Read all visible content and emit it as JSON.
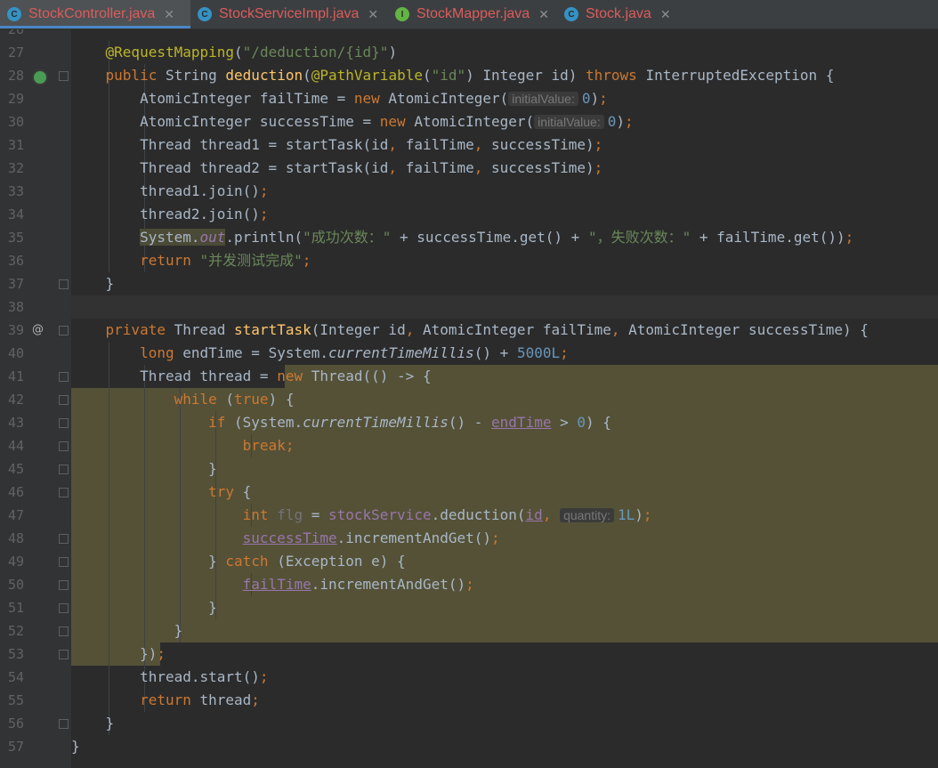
{
  "tabs": [
    {
      "label": "StockController.java",
      "icon": "class-icon",
      "icon_letter": "C",
      "icon_color": "#3592c4",
      "color": "#db5c5c",
      "active": true
    },
    {
      "label": "StockServiceImpl.java",
      "icon": "class-icon",
      "icon_letter": "C",
      "icon_color": "#3592c4",
      "color": "#db5c5c",
      "active": false
    },
    {
      "label": "StockMapper.java",
      "icon": "interface-icon",
      "icon_letter": "I",
      "icon_color": "#62b543",
      "color": "#db5c5c",
      "active": false
    },
    {
      "label": "Stock.java",
      "icon": "class-icon",
      "icon_letter": "C",
      "icon_color": "#3592c4",
      "color": "#db5c5c",
      "active": false
    }
  ],
  "close_glyph": "✕",
  "gutter_icons": {
    "line28": "run-controller-icon",
    "line39": "override-icon",
    "line39_glyph": "@"
  },
  "lines": [
    {
      "n": "26",
      "t": []
    },
    {
      "n": "27",
      "t": [
        [
          "    "
        ],
        [
          "@RequestMapping",
          "ann"
        ],
        [
          "("
        ],
        [
          "\"/deduction/{id}\"",
          "str"
        ],
        [
          ")"
        ]
      ]
    },
    {
      "n": "28",
      "t": [
        [
          "    "
        ],
        [
          "public ",
          "kw"
        ],
        [
          "String "
        ],
        [
          "deduction",
          "fn"
        ],
        [
          "("
        ],
        [
          "@PathVariable",
          "ann"
        ],
        [
          "("
        ],
        [
          "\"id\"",
          "str"
        ],
        [
          ") Integer id) "
        ],
        [
          "throws ",
          "kw"
        ],
        [
          "InterruptedException {"
        ]
      ]
    },
    {
      "n": "29",
      "t": [
        [
          "        AtomicInteger failTime = "
        ],
        [
          "new ",
          "kw"
        ],
        [
          "AtomicInteger("
        ],
        [
          "initialValue:",
          "hint"
        ],
        [
          "0",
          "num"
        ],
        [
          ")"
        ],
        [
          ";",
          "kw"
        ]
      ]
    },
    {
      "n": "30",
      "t": [
        [
          "        AtomicInteger successTime = "
        ],
        [
          "new ",
          "kw"
        ],
        [
          "AtomicInteger("
        ],
        [
          "initialValue:",
          "hint"
        ],
        [
          "0",
          "num"
        ],
        [
          ")"
        ],
        [
          ";",
          "kw"
        ]
      ]
    },
    {
      "n": "31",
      "t": [
        [
          "        Thread thread1 = startTask(id"
        ],
        [
          ", ",
          "kw"
        ],
        [
          "failTime"
        ],
        [
          ", ",
          "kw"
        ],
        [
          "successTime)"
        ],
        [
          ";",
          "kw"
        ]
      ]
    },
    {
      "n": "32",
      "t": [
        [
          "        Thread thread2 = startTask(id"
        ],
        [
          ", ",
          "kw"
        ],
        [
          "failTime"
        ],
        [
          ", ",
          "kw"
        ],
        [
          "successTime)"
        ],
        [
          ";",
          "kw"
        ]
      ]
    },
    {
      "n": "33",
      "t": [
        [
          "        thread1.join()"
        ],
        [
          ";",
          "kw"
        ]
      ]
    },
    {
      "n": "34",
      "t": [
        [
          "        thread2.join()"
        ],
        [
          ";",
          "kw"
        ]
      ]
    },
    {
      "n": "35",
      "t": [
        [
          "        "
        ],
        [
          "System.",
          "sysbg"
        ],
        [
          "out",
          "fld sysbg"
        ],
        [
          ".println("
        ],
        [
          "\"成功次数：\"",
          "str"
        ],
        [
          " + successTime.get() + "
        ],
        [
          "\"，失败次数：\"",
          "str"
        ],
        [
          " + failTime.get())"
        ],
        [
          ";",
          "kw"
        ]
      ]
    },
    {
      "n": "36",
      "t": [
        [
          "        "
        ],
        [
          "return ",
          "kw"
        ],
        [
          "\"并发测试完成\"",
          "str"
        ],
        [
          ";",
          "kw"
        ]
      ]
    },
    {
      "n": "37",
      "t": [
        [
          "    }"
        ]
      ]
    },
    {
      "n": "38",
      "t": []
    },
    {
      "n": "39",
      "t": [
        [
          "    "
        ],
        [
          "private ",
          "kw"
        ],
        [
          "Thread "
        ],
        [
          "startTask",
          "fn"
        ],
        [
          "(Integer id"
        ],
        [
          ", ",
          "kw"
        ],
        [
          "AtomicInteger failTime"
        ],
        [
          ", ",
          "kw"
        ],
        [
          "AtomicInteger successTime) {"
        ]
      ]
    },
    {
      "n": "40",
      "t": [
        [
          "        "
        ],
        [
          "long ",
          "kw"
        ],
        [
          "endTime = System."
        ],
        [
          "currentTimeMillis",
          "st"
        ],
        [
          "() + "
        ],
        [
          "5000L",
          "num"
        ],
        [
          ";",
          "kw"
        ]
      ]
    },
    {
      "n": "41",
      "t": [
        [
          "        Thread thread = "
        ],
        [
          "new ",
          "kw"
        ],
        [
          "Thread(() -> {"
        ]
      ]
    },
    {
      "n": "42",
      "t": [
        [
          "            "
        ],
        [
          "while ",
          "kw"
        ],
        [
          "("
        ],
        [
          "true",
          "kw"
        ],
        [
          ") {"
        ]
      ]
    },
    {
      "n": "43",
      "t": [
        [
          "                "
        ],
        [
          "if ",
          "kw"
        ],
        [
          "(System."
        ],
        [
          "currentTimeMillis",
          "st"
        ],
        [
          "() - "
        ],
        [
          "endTime",
          "ul"
        ],
        [
          " > "
        ],
        [
          "0",
          "num"
        ],
        [
          ") {"
        ]
      ]
    },
    {
      "n": "44",
      "t": [
        [
          "                    "
        ],
        [
          "break;",
          "kw"
        ]
      ]
    },
    {
      "n": "45",
      "t": [
        [
          "                }"
        ]
      ]
    },
    {
      "n": "46",
      "t": [
        [
          "                "
        ],
        [
          "try ",
          "kw"
        ],
        [
          "{"
        ]
      ]
    },
    {
      "n": "47",
      "t": [
        [
          "                    "
        ],
        [
          "int ",
          "kw"
        ],
        [
          "flg ",
          "gray"
        ],
        [
          "= "
        ],
        [
          "stockService",
          "inst"
        ],
        [
          ".deduction("
        ],
        [
          "id",
          "ul"
        ],
        [
          ", ",
          "kw"
        ],
        [
          "quantity:",
          "hint"
        ],
        [
          "1L",
          "num"
        ],
        [
          ")"
        ],
        [
          ";",
          "kw"
        ]
      ]
    },
    {
      "n": "48",
      "t": [
        [
          "                    "
        ],
        [
          "successTime",
          "ul"
        ],
        [
          ".incrementAndGet()"
        ],
        [
          ";",
          "kw"
        ]
      ]
    },
    {
      "n": "49",
      "t": [
        [
          "                } "
        ],
        [
          "catch ",
          "kw"
        ],
        [
          "(Exception e) {"
        ]
      ]
    },
    {
      "n": "50",
      "t": [
        [
          "                    "
        ],
        [
          "failTime",
          "ul"
        ],
        [
          ".incrementAndGet()"
        ],
        [
          ";",
          "kw"
        ]
      ]
    },
    {
      "n": "51",
      "t": [
        [
          "                }"
        ]
      ]
    },
    {
      "n": "52",
      "t": [
        [
          "            }"
        ]
      ]
    },
    {
      "n": "53",
      "t": [
        [
          "        })"
        ],
        [
          ";",
          "kw"
        ]
      ]
    },
    {
      "n": "54",
      "t": [
        [
          "        thread.start()"
        ],
        [
          ";",
          "kw"
        ]
      ]
    },
    {
      "n": "55",
      "t": [
        [
          "        "
        ],
        [
          "return ",
          "kw"
        ],
        [
          "thread"
        ],
        [
          ";",
          "kw"
        ]
      ]
    },
    {
      "n": "56",
      "t": [
        [
          "    }"
        ]
      ]
    },
    {
      "n": "57",
      "t": [
        [
          "}"
        ]
      ]
    }
  ]
}
